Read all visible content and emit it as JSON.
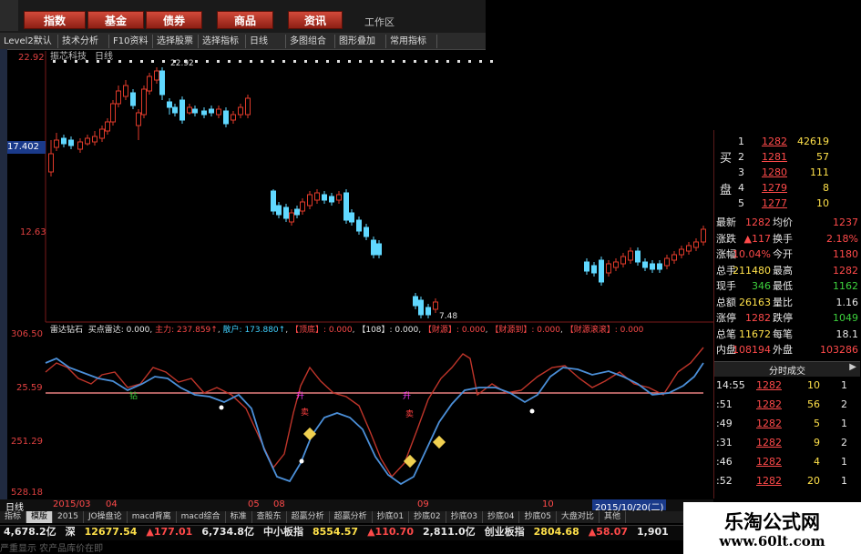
{
  "menu": [
    "指数",
    "基金",
    "债券",
    "商品",
    "资讯"
  ],
  "workarea": "工作区",
  "toolbar": [
    "Level2默认",
    "技术分析",
    "F10资料",
    "选择股票",
    "选择指标",
    "日线",
    "多图组合",
    "图形叠加",
    "常用指标"
  ],
  "chart": {
    "stock_name": "振芯科技",
    "period": "日线",
    "y_top": "22.92",
    "price_labels": [
      "22.92",
      "17.402",
      "12.63",
      "7.48"
    ],
    "marker_high": "22.92",
    "marker_low": "7.48"
  },
  "indicator": {
    "name": "雷达钻石",
    "title_parts": [
      "买点雷达: 0.000",
      "主力: 237.859↑",
      "散户: 173.880↑",
      "【顶底】: 0.000",
      "【108】: 0.000",
      "【财源】: 0.000",
      "【财源到】: 0.000",
      "【财源滚滚】: 0.000"
    ],
    "y_labels": [
      "306.50",
      "25.59",
      "251.29",
      "528.18"
    ],
    "signal_labels": [
      "钻",
      "升",
      "卖",
      "升",
      "卖"
    ]
  },
  "axis": {
    "period_btn": "日线",
    "dates": [
      "2015/03",
      "04",
      "05",
      "08",
      "09",
      "10"
    ],
    "current_date": "2015/10/20(二)"
  },
  "quote": {
    "buy_label": "买",
    "pan_label": "盘",
    "orders": [
      {
        "n": "1",
        "p": "1282",
        "v": "42619"
      },
      {
        "n": "2",
        "p": "1281",
        "v": "57"
      },
      {
        "n": "3",
        "p": "1280",
        "v": "111"
      },
      {
        "n": "4",
        "p": "1279",
        "v": "8"
      },
      {
        "n": "5",
        "p": "1277",
        "v": "10"
      }
    ],
    "stats": [
      [
        "最新",
        "1282",
        "均价",
        "1237"
      ],
      [
        "涨跌",
        "▲117",
        "换手",
        "2.18%"
      ],
      [
        "涨幅",
        "10.04%",
        "今开",
        "1180"
      ],
      [
        "总手",
        "211480",
        "最高",
        "1282"
      ],
      [
        "现手",
        "346",
        "最低",
        "1162"
      ],
      [
        "总额",
        "26163",
        "量比",
        "1.16"
      ],
      [
        "涨停",
        "1282",
        "跌停",
        "1049"
      ],
      [
        "总笔",
        "11672",
        "每笔",
        "18.1"
      ],
      [
        "内盘",
        "108194",
        "外盘",
        "103286"
      ]
    ],
    "ticks_title": "分时成交",
    "ticks": [
      [
        "14:55",
        "1282",
        "10",
        "1"
      ],
      [
        ":51",
        "1282",
        "56",
        "2"
      ],
      [
        ":49",
        "1282",
        "5",
        "1"
      ],
      [
        ":31",
        "1282",
        "9",
        "2"
      ],
      [
        ":46",
        "1282",
        "4",
        "1"
      ],
      [
        ":52",
        "1282",
        "20",
        "1"
      ]
    ]
  },
  "bottom_tabs": [
    "指标",
    "模版",
    "2015",
    "JO操盘论",
    "macd背离",
    "macd综合",
    "标准",
    "查股东",
    "超赢分析",
    "超赢分析",
    "抄底01",
    "抄底02",
    "抄底03",
    "抄底04",
    "抄底05",
    "大盘对比",
    "其他"
  ],
  "ticker": [
    {
      "t": "4,678.2亿",
      "c": "white"
    },
    {
      "t": "深",
      "c": "white"
    },
    {
      "t": "12677.54",
      "c": "yellow"
    },
    {
      "t": "▲177.01",
      "c": "red"
    },
    {
      "t": "6,734.8亿",
      "c": "white"
    },
    {
      "t": "中小板指",
      "c": "white"
    },
    {
      "t": "8554.57",
      "c": "yellow"
    },
    {
      "t": "▲110.70",
      "c": "red"
    },
    {
      "t": "2,811.0亿",
      "c": "white"
    },
    {
      "t": "创业板指",
      "c": "white"
    },
    {
      "t": "2804.68",
      "c": "yellow"
    },
    {
      "t": "▲58.07",
      "c": "red"
    },
    {
      "t": "1,901",
      "c": "white"
    }
  ],
  "footer_text": "严重显示 农产品库价在即",
  "brand": {
    "title": "乐淘公式网",
    "url": "www.60lt.com"
  }
}
